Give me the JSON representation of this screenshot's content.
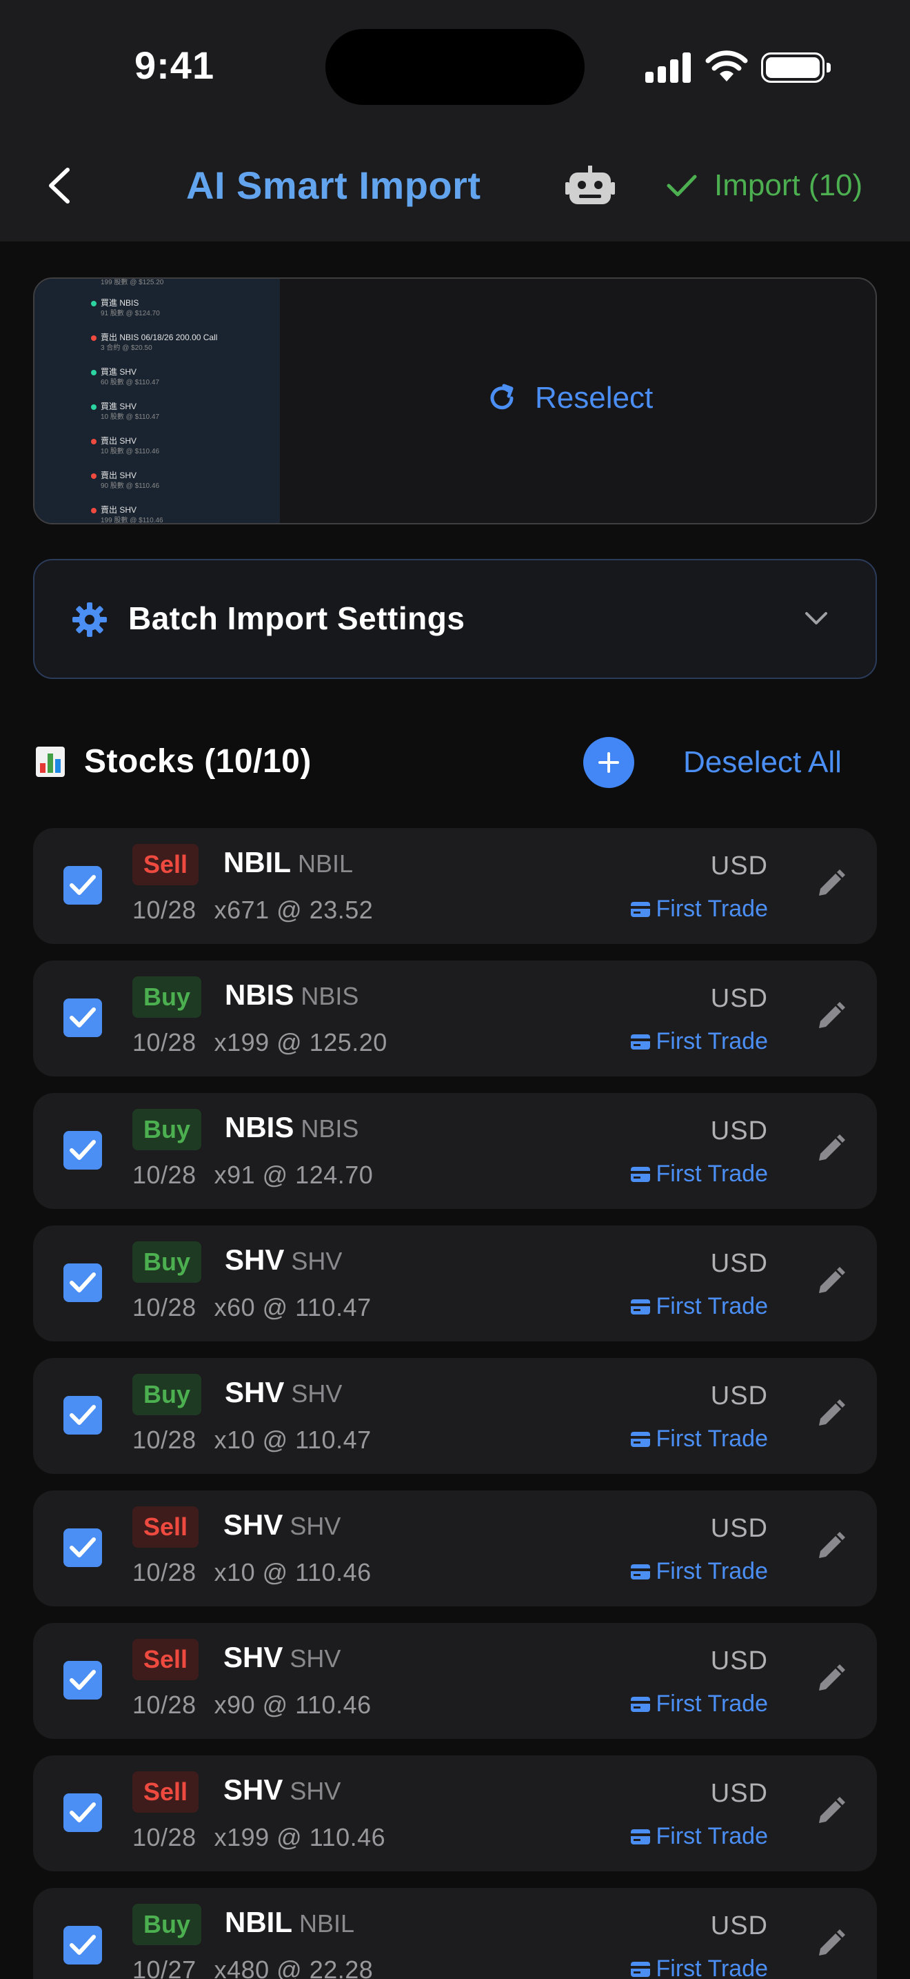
{
  "status_bar": {
    "time": "9:41"
  },
  "header": {
    "title": "AI Smart Import",
    "import_label": "Import (10)"
  },
  "preview": {
    "reselect_label": "Reselect",
    "thumbnail_rows": [
      {
        "title": "",
        "sub": "199 股數 @ $125.20",
        "dot": ""
      },
      {
        "title": "買進 NBIS",
        "sub": "91 股數 @ $124.70",
        "dot": "#2bd4a0"
      },
      {
        "title": "賣出 NBIS 06/18/26 200.00 Call",
        "sub": "3 合約 @ $20.50",
        "dot": "#ef4a3f"
      },
      {
        "title": "買進 SHV",
        "sub": "60 股數 @ $110.47",
        "dot": "#2bd4a0"
      },
      {
        "title": "買進 SHV",
        "sub": "10 股數 @ $110.47",
        "dot": "#2bd4a0"
      },
      {
        "title": "賣出 SHV",
        "sub": "10 股數 @ $110.46",
        "dot": "#ef4a3f"
      },
      {
        "title": "賣出 SHV",
        "sub": "90 股數 @ $110.46",
        "dot": "#ef4a3f"
      },
      {
        "title": "賣出 SHV",
        "sub": "199 股數 @ $110.46",
        "dot": "#ef4a3f"
      }
    ]
  },
  "settings": {
    "label": "Batch Import Settings"
  },
  "stocks": {
    "title": "Stocks (10/10)",
    "deselect_label": "Deselect All",
    "items": [
      {
        "action": "Sell",
        "type": "sell",
        "symbol": "NBIL",
        "code": "NBIL",
        "date": "10/28",
        "qty_price": "x671 @ 23.52",
        "currency": "USD",
        "account": "First Trade"
      },
      {
        "action": "Buy",
        "type": "buy",
        "symbol": "NBIS",
        "code": "NBIS",
        "date": "10/28",
        "qty_price": "x199 @ 125.20",
        "currency": "USD",
        "account": "First Trade"
      },
      {
        "action": "Buy",
        "type": "buy",
        "symbol": "NBIS",
        "code": "NBIS",
        "date": "10/28",
        "qty_price": "x91 @ 124.70",
        "currency": "USD",
        "account": "First Trade"
      },
      {
        "action": "Buy",
        "type": "buy",
        "symbol": "SHV",
        "code": "SHV",
        "date": "10/28",
        "qty_price": "x60 @ 110.47",
        "currency": "USD",
        "account": "First Trade"
      },
      {
        "action": "Buy",
        "type": "buy",
        "symbol": "SHV",
        "code": "SHV",
        "date": "10/28",
        "qty_price": "x10 @ 110.47",
        "currency": "USD",
        "account": "First Trade"
      },
      {
        "action": "Sell",
        "type": "sell",
        "symbol": "SHV",
        "code": "SHV",
        "date": "10/28",
        "qty_price": "x10 @ 110.46",
        "currency": "USD",
        "account": "First Trade"
      },
      {
        "action": "Sell",
        "type": "sell",
        "symbol": "SHV",
        "code": "SHV",
        "date": "10/28",
        "qty_price": "x90 @ 110.46",
        "currency": "USD",
        "account": "First Trade"
      },
      {
        "action": "Sell",
        "type": "sell",
        "symbol": "SHV",
        "code": "SHV",
        "date": "10/28",
        "qty_price": "x199 @ 110.46",
        "currency": "USD",
        "account": "First Trade"
      },
      {
        "action": "Buy",
        "type": "buy",
        "symbol": "NBIL",
        "code": "NBIL",
        "date": "10/27",
        "qty_price": "x480 @ 22.28",
        "currency": "USD",
        "account": "First Trade"
      }
    ]
  }
}
